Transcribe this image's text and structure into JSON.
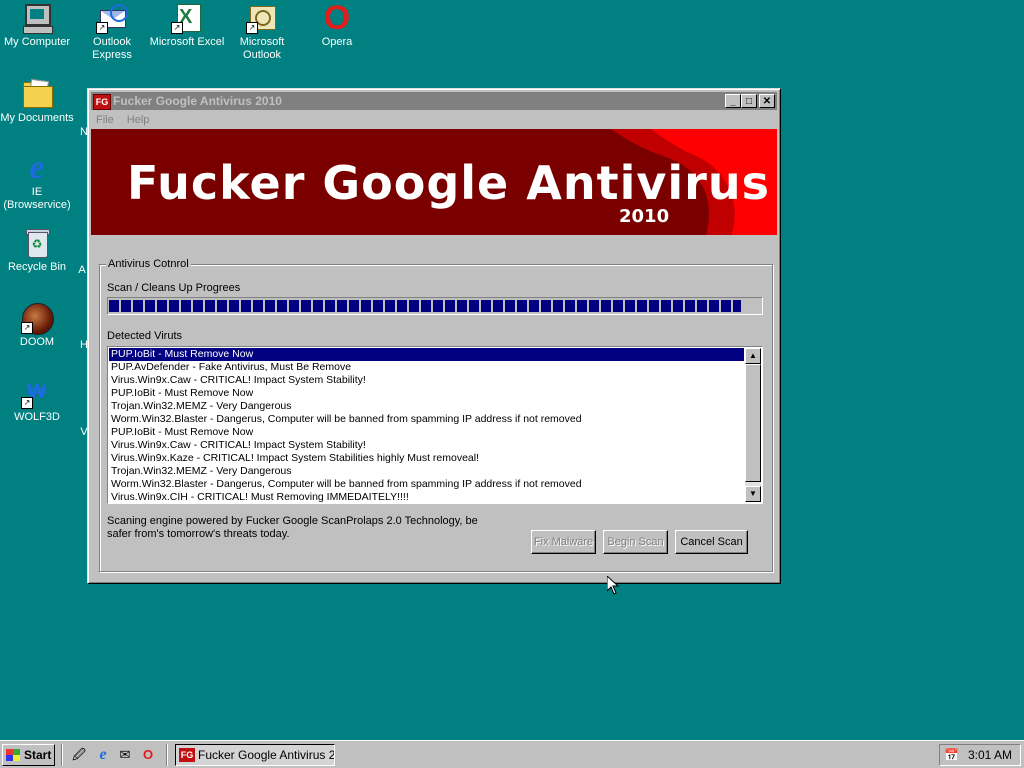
{
  "desktop": {
    "icons": [
      {
        "label": "My Computer"
      },
      {
        "label": "Outlook Express"
      },
      {
        "label": "Microsoft Excel"
      },
      {
        "label": "Microsoft Outlook"
      },
      {
        "label": "Opera"
      },
      {
        "label": "My Documents"
      },
      {
        "label": "IE (Browservice)"
      },
      {
        "label": "Recycle Bin"
      },
      {
        "label": "DOOM"
      },
      {
        "label": "WOLF3D"
      }
    ],
    "partial_labels": [
      "N",
      "A",
      "H",
      "V"
    ]
  },
  "window": {
    "title": "Fucker Google Antivirus 2010",
    "app_icon_text": "FG",
    "menu": [
      "File",
      "Help"
    ],
    "banner": {
      "title": "Fucker Google Antivirus",
      "year": "2010"
    },
    "group_label": "Antivirus Cotnrol",
    "scan_label": "Scan / Cleans Up Progrees",
    "progress_percent": 97,
    "detected_label": "Detected Viruts",
    "detected": [
      "PUP.IoBit - Must Remove Now",
      "PUP.AvDefender - Fake Antivirus, Must Be Remove",
      "Virus.Win9x.Caw - CRITICAL! Impact System Stability!",
      "PUP.IoBit - Must Remove Now",
      "Trojan.Win32.MEMZ - Very Dangerous",
      "Worm.Win32.Blaster - Dangerus, Computer will be banned from spamming IP address if not removed",
      "PUP.IoBit - Must Remove Now",
      "Virus.Win9x.Caw - CRITICAL! Impact System Stability!",
      "Virus.Win9x.Kaze - CRITICAL! Impact System Stabilities highly Must removeal!",
      "Trojan.Win32.MEMZ - Very Dangerous",
      "Worm.Win32.Blaster - Dangerus, Computer will be banned from spamming IP address if not removed",
      "Virus.Win9x.CIH - CRITICAL! Must Removing IMMEDAITELY!!!!"
    ],
    "selected_index": 0,
    "footer": "Scaning engine powered by Fucker Google ScanProlaps 2.0 Technology, be safer from's tomorrow's threats today.",
    "buttons": {
      "fix": "Fix Malware",
      "begin": "Begin Scan",
      "cancel": "Cancel Scan"
    }
  },
  "taskbar": {
    "start_label": "Start",
    "task_label": "Fucker Google Antivirus 2...",
    "clock": "3:01 AM"
  },
  "colors": {
    "desktop": "#008080",
    "banner_dark": "#7a0000",
    "banner_red": "#ff0000",
    "selection": "#000080"
  }
}
